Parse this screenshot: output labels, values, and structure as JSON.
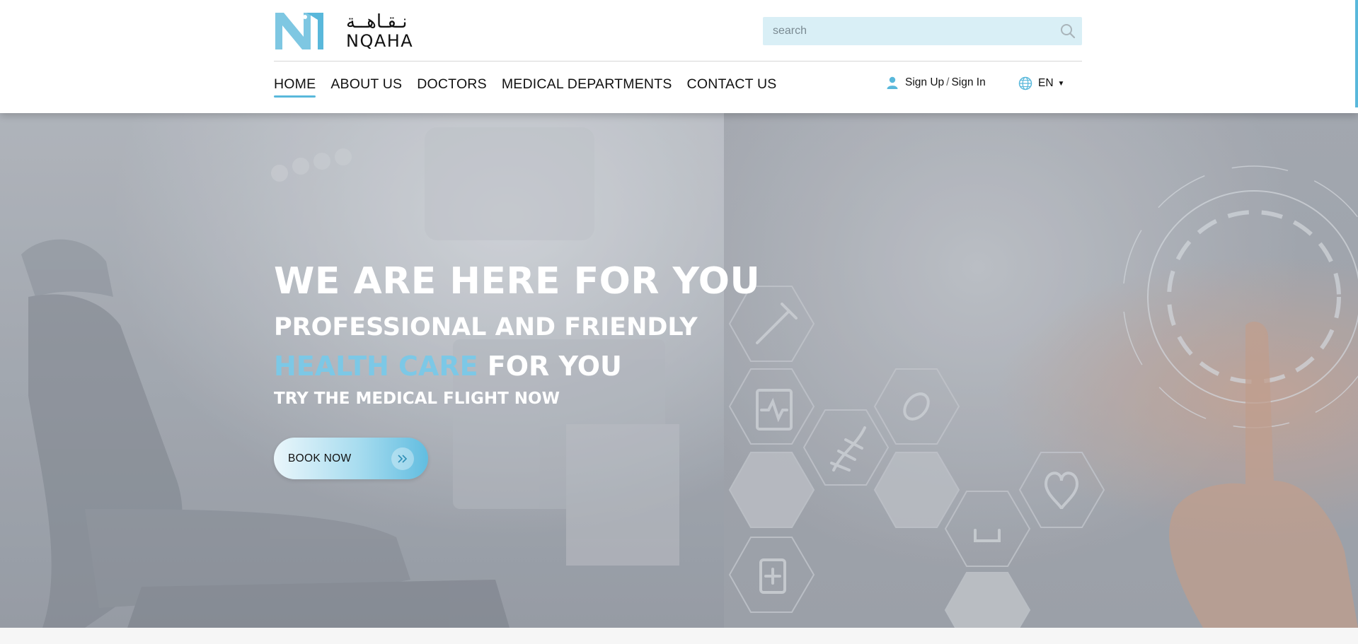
{
  "brand": {
    "name_ar": "نـقـاهــة",
    "name_en": "NQAHA",
    "accent_color": "#59b8db"
  },
  "search": {
    "placeholder": "search",
    "value": "",
    "icon": "search-icon"
  },
  "nav": {
    "items": [
      {
        "label": "HOME",
        "active": true
      },
      {
        "label": "ABOUT US",
        "active": false
      },
      {
        "label": "DOCTORS",
        "active": false
      },
      {
        "label": "MEDICAL DEPARTMENTS",
        "active": false
      },
      {
        "label": "CONTACT US",
        "active": false
      }
    ]
  },
  "account": {
    "icon": "user-icon",
    "sign_up": "Sign Up",
    "separator": "/",
    "sign_in": "Sign In"
  },
  "language": {
    "icon": "globe-icon",
    "value": "EN"
  },
  "hero": {
    "line1": "WE ARE HERE FOR YOU",
    "line2": "PROFESSIONAL AND FRIENDLY",
    "line3_accent": "HEALTH CARE",
    "line3_rest": "FOR YOU",
    "line4": "TRY THE MEDICAL FLIGHT NOW",
    "accent_color": "#7cc8e6",
    "cta_label": "BOOK NOW",
    "cta_icon": "double-chevron-right-icon",
    "background": "dental-chair-and-medical-hexagon-icons-photo"
  }
}
